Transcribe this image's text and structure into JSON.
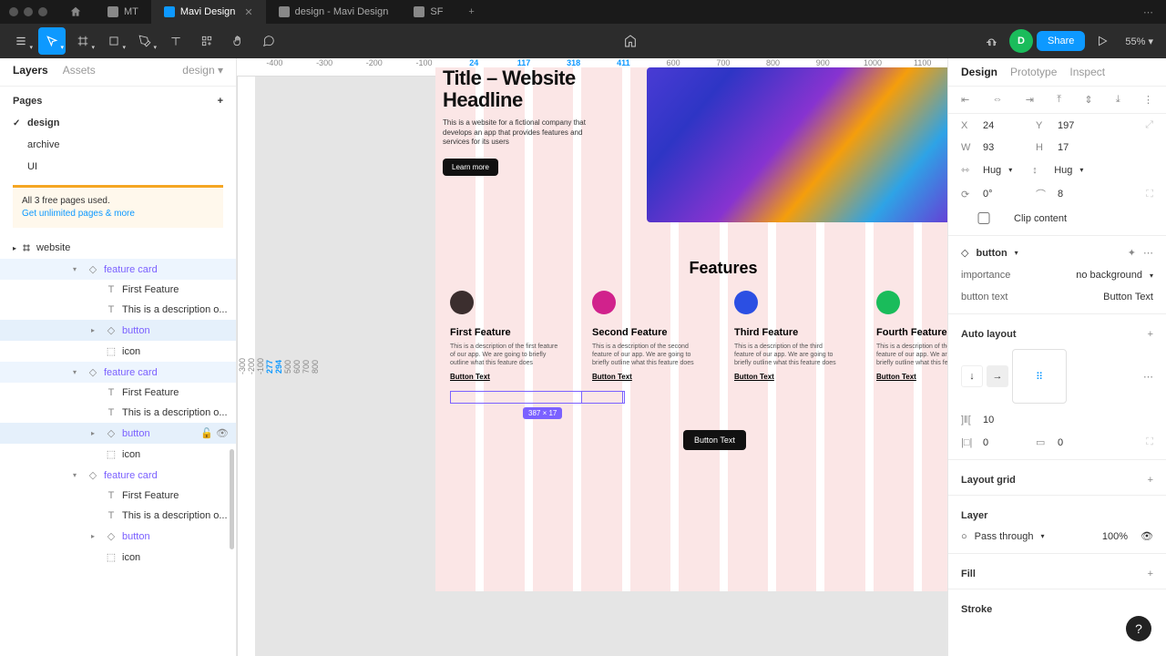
{
  "tabs": {
    "items": [
      {
        "label": "MT",
        "color": "#888"
      },
      {
        "label": "Mavi Design",
        "color": "#0d99ff",
        "active": true
      },
      {
        "label": "design - Mavi Design",
        "color": "#888"
      },
      {
        "label": "SF",
        "color": "#888"
      }
    ]
  },
  "toolbar": {
    "zoom": "55%",
    "share": "Share",
    "avatar": "D"
  },
  "left": {
    "tabs": {
      "layers": "Layers",
      "assets": "Assets",
      "design": "design"
    },
    "pages_label": "Pages",
    "pages": [
      {
        "name": "design",
        "active": true
      },
      {
        "name": "archive"
      },
      {
        "name": "UI"
      }
    ],
    "promo": {
      "line1": "All 3 free pages used.",
      "link": "Get unlimited pages & more"
    },
    "frame": "website",
    "layers": [
      {
        "ind": 80,
        "caret": "▾",
        "ico": "◇",
        "lbl": "feature card",
        "cls": "soft purple"
      },
      {
        "ind": 100,
        "ico": "T",
        "lbl": "First Feature"
      },
      {
        "ind": 100,
        "ico": "T",
        "lbl": "This is a description o..."
      },
      {
        "ind": 100,
        "caret": "▸",
        "ico": "◇",
        "lbl": "button",
        "cls": "sel purple"
      },
      {
        "ind": 100,
        "ico": "⬚",
        "lbl": "icon"
      },
      {
        "ind": 80,
        "caret": "▾",
        "ico": "◇",
        "lbl": "feature card",
        "cls": "soft purple"
      },
      {
        "ind": 100,
        "ico": "T",
        "lbl": "First Feature"
      },
      {
        "ind": 100,
        "ico": "T",
        "lbl": "This is a description o..."
      },
      {
        "ind": 100,
        "caret": "▸",
        "ico": "◇",
        "lbl": "button",
        "cls": "sel purple",
        "actions": true
      },
      {
        "ind": 100,
        "ico": "⬚",
        "lbl": "icon"
      },
      {
        "ind": 80,
        "caret": "▾",
        "ico": "◇",
        "lbl": "feature card",
        "cls": "purple"
      },
      {
        "ind": 100,
        "ico": "T",
        "lbl": "First Feature"
      },
      {
        "ind": 100,
        "ico": "T",
        "lbl": "This is a description o..."
      },
      {
        "ind": 100,
        "caret": "▸",
        "ico": "◇",
        "lbl": "button",
        "cls": "purple"
      },
      {
        "ind": 100,
        "ico": "⬚",
        "lbl": "icon"
      }
    ]
  },
  "ruler_h": [
    {
      "t": "-400"
    },
    {
      "t": "-300"
    },
    {
      "t": "-200"
    },
    {
      "t": "-100"
    },
    {
      "t": "24",
      "b": 1
    },
    {
      "t": "117",
      "b": 1
    },
    {
      "t": "318",
      "b": 1
    },
    {
      "t": "411",
      "b": 1
    },
    {
      "t": "600"
    },
    {
      "t": "700"
    },
    {
      "t": "800"
    },
    {
      "t": "900"
    },
    {
      "t": "1000"
    },
    {
      "t": "1100"
    }
  ],
  "ruler_v": [
    "-300",
    "-200",
    "-100",
    "277",
    "294",
    "500",
    "600",
    "700",
    "800"
  ],
  "hero": {
    "title": "Title – Website Headline",
    "sub": "This is a website for a fictional company that develops an app that provides features and services for its users",
    "cta": "Learn more"
  },
  "features": {
    "title": "Features",
    "cards": [
      {
        "t": "First Feature",
        "d": "This is a description of the first feature of our app. We are going to briefly outline what this feature does",
        "bt": "Button Text"
      },
      {
        "t": "Second Feature",
        "d": "This is a description of the second feature of our app. We are going to briefly outline what this feature does",
        "bt": "Button Text"
      },
      {
        "t": "Third Feature",
        "d": "This is a description of the third feature of our app. We are going to briefly outline what this feature does",
        "bt": "Button Text"
      },
      {
        "t": "Fourth Feature",
        "d": "This is a description of the fourth feature of our app. We are going to briefly outline what this feature does",
        "bt": "Button Text"
      }
    ],
    "size_badge": "387 × 17",
    "big_btn": "Button Text"
  },
  "right": {
    "tabs": {
      "design": "Design",
      "prototype": "Prototype",
      "inspect": "Inspect"
    },
    "x": "24",
    "y": "197",
    "w": "93",
    "h": "17",
    "hug": "Hug",
    "rot": "0°",
    "rad": "8",
    "clip": "Clip content",
    "instance": "button",
    "importance": {
      "k": "importance",
      "v": "no background"
    },
    "button_text": {
      "k": "button text",
      "v": "Button Text"
    },
    "autolayout": "Auto layout",
    "al_gap": "10",
    "al_p1": "0",
    "al_p2": "0",
    "layoutgrid": "Layout grid",
    "layer": "Layer",
    "pass": "Pass through",
    "opacity": "100%",
    "fill": "Fill",
    "stroke": "Stroke"
  }
}
